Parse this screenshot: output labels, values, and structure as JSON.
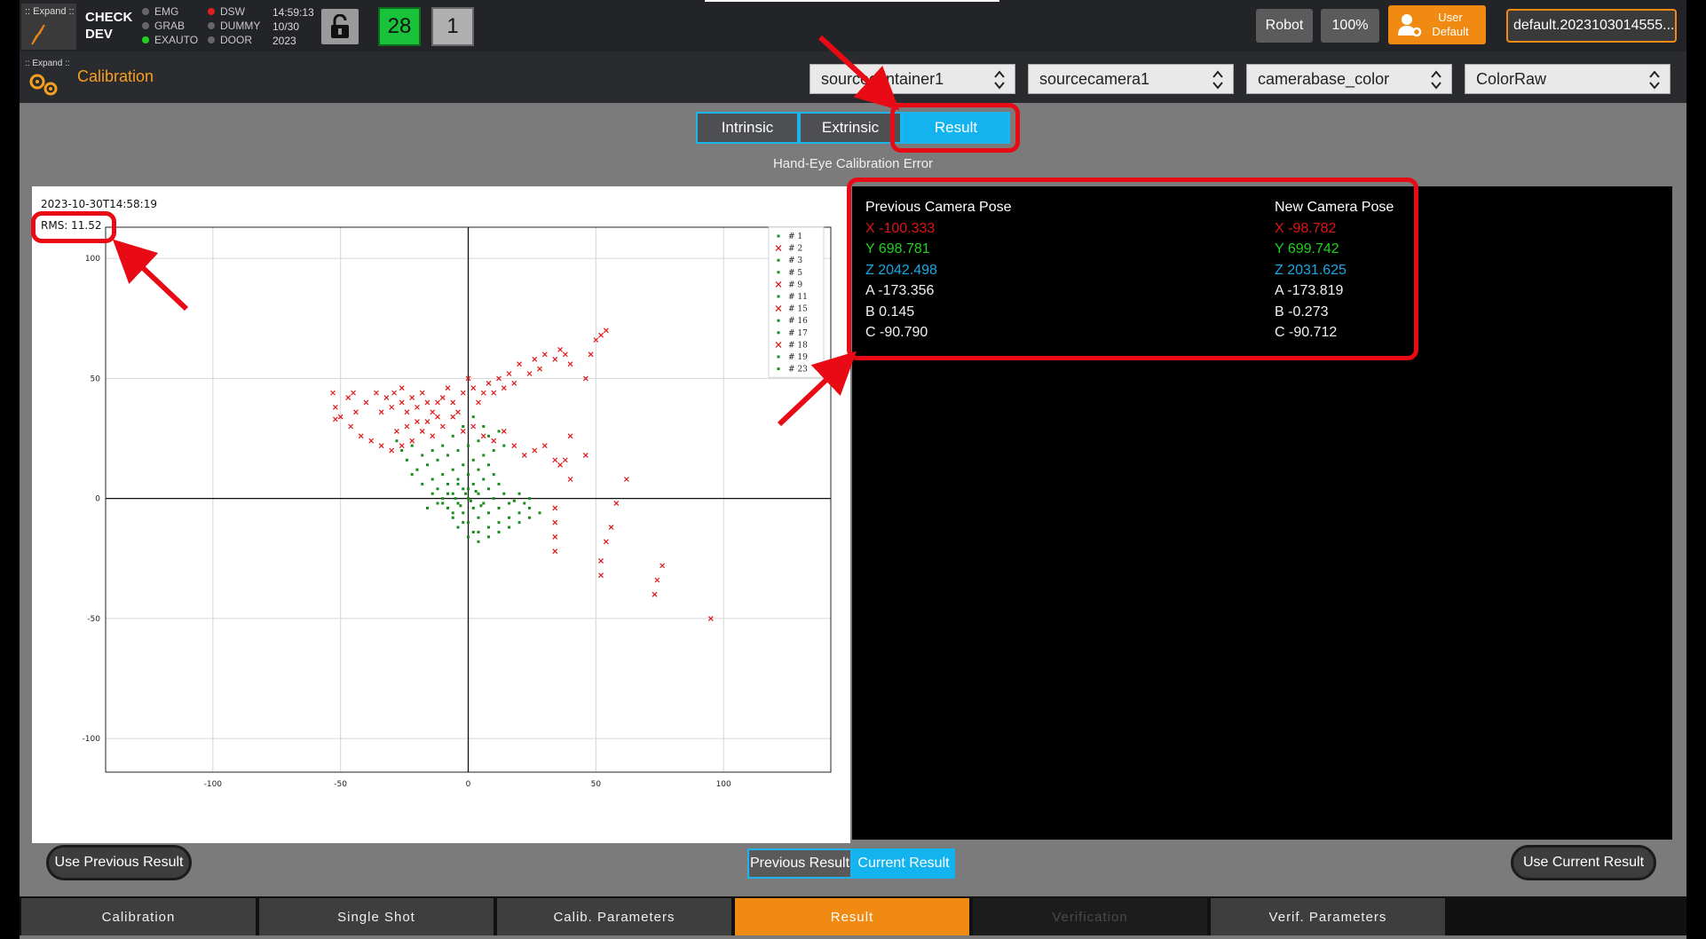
{
  "status": {
    "logo_text": ":: Expand ::",
    "mode_line1": "CHECK",
    "mode_line2": "DEV",
    "indicators": [
      {
        "label": "EMG",
        "color": "#666666"
      },
      {
        "label": "GRAB",
        "color": "#666666"
      },
      {
        "label": "EXAUTO",
        "color": "#1fd21f"
      },
      {
        "label": "DSW",
        "color": "#e02020"
      },
      {
        "label": "DUMMY",
        "color": "#666666"
      },
      {
        "label": "DOOR",
        "color": "#666666"
      }
    ],
    "time": "14:59:13",
    "date": "10/30",
    "year": "2023",
    "count_green": "28",
    "count_gray": "1",
    "robot_label": "Robot",
    "speed_label": "100%",
    "user_line1": "User",
    "user_line2": "Default",
    "file_label": "default.2023103014555..."
  },
  "titlebar": {
    "logo_text": ":: Expand ::",
    "title": "Calibration",
    "selects": [
      "sourcecontainer1",
      "sourcecamera1",
      "camerabase_color",
      "ColorRaw"
    ]
  },
  "tabs": {
    "intrinsic": "Intrinsic",
    "extrinsic": "Extrinsic",
    "result": "Result"
  },
  "chart_title": "Hand-Eye Calibration Error",
  "plot": {
    "timestamp": "2023-10-30T14:58:19",
    "rms": "RMS: 11.52"
  },
  "chart_data": {
    "type": "scatter",
    "xlim": [
      -142,
      142
    ],
    "ylim": [
      -114,
      113
    ],
    "x_ticks": [
      -100,
      -50,
      0,
      50,
      100
    ],
    "y_ticks": [
      100,
      50,
      0,
      -50,
      -100
    ],
    "legend_position": "top-right",
    "legend": [
      {
        "name": "# 1",
        "marker": "dot",
        "color": "#1a8c1a"
      },
      {
        "name": "# 2",
        "marker": "x",
        "color": "#e01515"
      },
      {
        "name": "# 3",
        "marker": "dot",
        "color": "#1a8c1a"
      },
      {
        "name": "# 5",
        "marker": "dot",
        "color": "#1a8c1a"
      },
      {
        "name": "# 9",
        "marker": "x",
        "color": "#e01515"
      },
      {
        "name": "# 11",
        "marker": "dot",
        "color": "#1a8c1a"
      },
      {
        "name": "# 15",
        "marker": "x",
        "color": "#e01515"
      },
      {
        "name": "# 16",
        "marker": "dot",
        "color": "#1a8c1a"
      },
      {
        "name": "# 17",
        "marker": "dot",
        "color": "#1a8c1a"
      },
      {
        "name": "# 18",
        "marker": "x",
        "color": "#e01515"
      },
      {
        "name": "# 19",
        "marker": "dot",
        "color": "#1a8c1a"
      },
      {
        "name": "# 23",
        "marker": "dot",
        "color": "#1a8c1a"
      }
    ],
    "series": [
      {
        "color": "#e01515",
        "marker": "x",
        "points": [
          [
            -53,
            44
          ],
          [
            -52,
            38
          ],
          [
            -52,
            33
          ],
          [
            -47,
            42
          ],
          [
            -44,
            36
          ],
          [
            -45,
            44
          ],
          [
            -40,
            40
          ],
          [
            -36,
            44
          ],
          [
            -34,
            36
          ],
          [
            -32,
            42
          ],
          [
            -30,
            38
          ],
          [
            -29,
            44
          ],
          [
            -26,
            40
          ],
          [
            -26,
            46
          ],
          [
            -24,
            36
          ],
          [
            -22,
            42
          ],
          [
            -20,
            38
          ],
          [
            -18,
            44
          ],
          [
            -16,
            40
          ],
          [
            -14,
            36
          ],
          [
            -12,
            40
          ],
          [
            -10,
            42
          ],
          [
            -8,
            46
          ],
          [
            -6,
            40
          ],
          [
            -4,
            36
          ],
          [
            -2,
            44
          ],
          [
            0,
            50
          ],
          [
            2,
            46
          ],
          [
            4,
            40
          ],
          [
            6,
            44
          ],
          [
            8,
            48
          ],
          [
            10,
            44
          ],
          [
            12,
            50
          ],
          [
            14,
            46
          ],
          [
            16,
            52
          ],
          [
            18,
            48
          ],
          [
            20,
            56
          ],
          [
            24,
            52
          ],
          [
            26,
            58
          ],
          [
            28,
            54
          ],
          [
            30,
            60
          ],
          [
            34,
            58
          ],
          [
            36,
            62
          ],
          [
            38,
            60
          ],
          [
            40,
            56
          ],
          [
            46,
            50
          ],
          [
            48,
            60
          ],
          [
            50,
            66
          ],
          [
            52,
            68
          ],
          [
            54,
            70
          ],
          [
            -38,
            24
          ],
          [
            -34,
            22
          ],
          [
            -30,
            20
          ],
          [
            -26,
            22
          ],
          [
            -22,
            24
          ],
          [
            -18,
            28
          ],
          [
            -14,
            26
          ],
          [
            -10,
            30
          ],
          [
            -6,
            34
          ],
          [
            -2,
            28
          ],
          [
            2,
            30
          ],
          [
            6,
            26
          ],
          [
            10,
            24
          ],
          [
            14,
            28
          ],
          [
            18,
            22
          ],
          [
            22,
            18
          ],
          [
            26,
            20
          ],
          [
            30,
            22
          ],
          [
            34,
            16
          ],
          [
            36,
            14
          ],
          [
            38,
            16
          ],
          [
            40,
            26
          ],
          [
            46,
            18
          ],
          [
            40,
            8
          ],
          [
            62,
            8
          ],
          [
            58,
            -2
          ],
          [
            56,
            -12
          ],
          [
            54,
            -18
          ],
          [
            34,
            -4
          ],
          [
            34,
            -10
          ],
          [
            34,
            -16
          ],
          [
            34,
            -22
          ],
          [
            52,
            -26
          ],
          [
            52,
            -32
          ],
          [
            76,
            -28
          ],
          [
            74,
            -34
          ],
          [
            73,
            -40
          ],
          [
            95,
            -50
          ],
          [
            -42,
            26
          ],
          [
            -46,
            30
          ],
          [
            -50,
            34
          ],
          [
            -12,
            34
          ],
          [
            -16,
            32
          ],
          [
            -20,
            32
          ],
          [
            -24,
            30
          ],
          [
            -28,
            28
          ]
        ]
      },
      {
        "color": "#1a8c1a",
        "marker": "dot",
        "points": [
          [
            -22,
            10
          ],
          [
            -18,
            6
          ],
          [
            -14,
            2
          ],
          [
            -10,
            -2
          ],
          [
            -6,
            -6
          ],
          [
            -2,
            -10
          ],
          [
            2,
            -14
          ],
          [
            -20,
            12
          ],
          [
            -16,
            14
          ],
          [
            -12,
            16
          ],
          [
            -8,
            18
          ],
          [
            -4,
            20
          ],
          [
            0,
            22
          ],
          [
            4,
            24
          ],
          [
            8,
            26
          ],
          [
            12,
            28
          ],
          [
            -14,
            8
          ],
          [
            -10,
            10
          ],
          [
            -6,
            12
          ],
          [
            -2,
            14
          ],
          [
            2,
            16
          ],
          [
            6,
            18
          ],
          [
            10,
            20
          ],
          [
            14,
            22
          ],
          [
            -12,
            4
          ],
          [
            -8,
            6
          ],
          [
            -4,
            8
          ],
          [
            0,
            10
          ],
          [
            4,
            12
          ],
          [
            8,
            14
          ],
          [
            -10,
            0
          ],
          [
            -6,
            2
          ],
          [
            -2,
            4
          ],
          [
            2,
            6
          ],
          [
            6,
            8
          ],
          [
            10,
            10
          ],
          [
            -8,
            -4
          ],
          [
            -4,
            -2
          ],
          [
            0,
            0
          ],
          [
            4,
            2
          ],
          [
            8,
            4
          ],
          [
            12,
            6
          ],
          [
            -6,
            -8
          ],
          [
            -2,
            -6
          ],
          [
            2,
            -4
          ],
          [
            6,
            -2
          ],
          [
            10,
            0
          ],
          [
            14,
            2
          ],
          [
            -4,
            -12
          ],
          [
            0,
            -10
          ],
          [
            4,
            -8
          ],
          [
            8,
            -6
          ],
          [
            12,
            -4
          ],
          [
            16,
            -2
          ],
          [
            0,
            -16
          ],
          [
            4,
            -14
          ],
          [
            8,
            -12
          ],
          [
            12,
            -10
          ],
          [
            16,
            -8
          ],
          [
            20,
            -6
          ],
          [
            24,
            -4
          ],
          [
            4,
            -18
          ],
          [
            8,
            -16
          ],
          [
            12,
            -14
          ],
          [
            16,
            -12
          ],
          [
            20,
            -10
          ],
          [
            24,
            -8
          ],
          [
            28,
            -6
          ],
          [
            -24,
            16
          ],
          [
            -26,
            20
          ],
          [
            -28,
            24
          ],
          [
            -8,
            2
          ],
          [
            -12,
            -2
          ],
          [
            -16,
            -4
          ],
          [
            -4,
            6
          ],
          [
            0,
            4
          ],
          [
            -6,
            26
          ],
          [
            -2,
            30
          ],
          [
            -10,
            22
          ],
          [
            -14,
            20
          ],
          [
            -18,
            18
          ],
          [
            -22,
            22
          ],
          [
            6,
            30
          ],
          [
            2,
            34
          ],
          [
            -3,
            -3
          ],
          [
            -1,
            2
          ],
          [
            1,
            -1
          ],
          [
            3,
            3
          ],
          [
            -5,
            0
          ],
          [
            5,
            -3
          ],
          [
            18,
            -1
          ],
          [
            22,
            -2
          ],
          [
            20,
            2
          ],
          [
            24,
            0
          ]
        ]
      }
    ]
  },
  "previous_pose": {
    "title": "Previous Camera Pose",
    "x": "X -100.333",
    "y": "Y 698.781",
    "z": "Z 2042.498",
    "a": "A -173.356",
    "b": "B 0.145",
    "c": "C -90.790"
  },
  "new_pose": {
    "title": "New Camera Pose",
    "x": "X -98.782",
    "y": "Y 699.742",
    "z": "Z 2031.625",
    "a": "A -173.819",
    "b": "B -0.273",
    "c": "C -90.712"
  },
  "bottom": {
    "use_previous": "Use Previous Result",
    "use_current": "Use Current Result",
    "toggle_previous": "Previous Result",
    "toggle_current": "Current Result"
  },
  "nav": [
    "Calibration",
    "Single Shot",
    "Calib. Parameters",
    "Result",
    "Verification",
    "Verif. Parameters"
  ],
  "colors": {
    "accent_orange": "#f08a12",
    "accent_blue": "#12b3ef",
    "annotation_red": "#e80a14"
  }
}
